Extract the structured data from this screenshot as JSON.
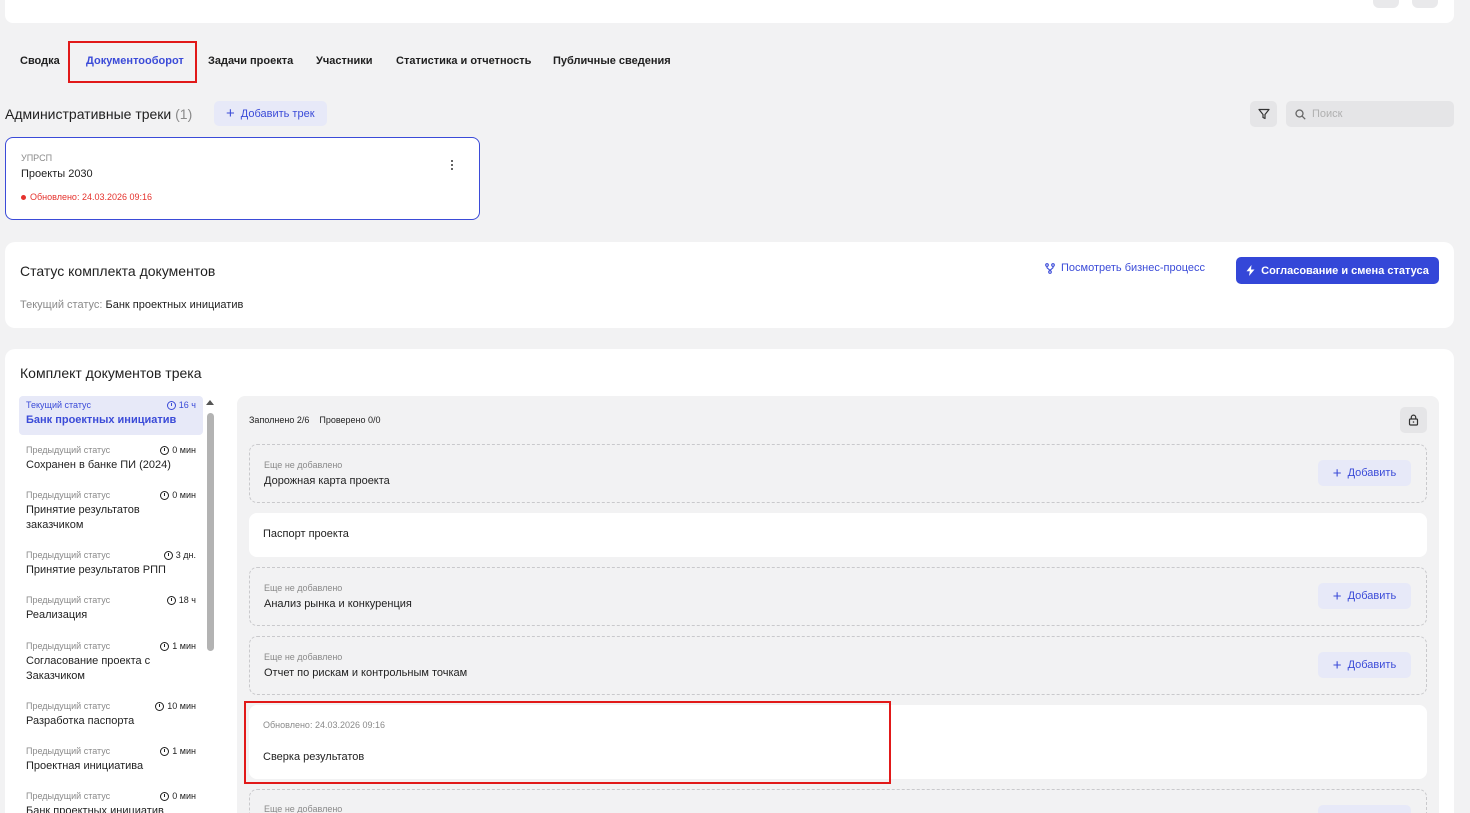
{
  "tabs": [
    {
      "label": "Сводка"
    },
    {
      "label": "Документооборот"
    },
    {
      "label": "Задачи проекта"
    },
    {
      "label": "Участники"
    },
    {
      "label": "Статистика и отчетность"
    },
    {
      "label": "Публичные сведения"
    }
  ],
  "active_tab": "Документооборот",
  "admin_tracks": {
    "title": "Административные треки",
    "count": "(1)",
    "add_label": "Добавить трек",
    "search_placeholder": "Поиск"
  },
  "track": {
    "code": "УПРСП",
    "name": "Проекты 2030",
    "updated": "Обновлено: 24.03.2026 09:16"
  },
  "status_card": {
    "title": "Статус комплекта документов",
    "current_label": "Текущий статус:",
    "current_value": "Банк проектных инициатив",
    "view_process": "Посмотреть бизнес-процесс",
    "approve_button": "Согласование и смена статуса"
  },
  "docs": {
    "title": "Комплект документов трека",
    "filled": "Заполнено 2/6",
    "checked": "Проверено 0/0",
    "add_label": "Добавить",
    "items": [
      {
        "sub": "Еще не добавлено",
        "name": "Дорожная карта проекта"
      },
      {
        "sub": "",
        "name": "Паспорт проекта"
      },
      {
        "sub": "Еще не добавлено",
        "name": "Анализ рынка и конкуренция"
      },
      {
        "sub": "Еще не добавлено",
        "name": "Отчет по рискам и контрольным точкам"
      },
      {
        "sub": "Обновлено: 24.03.2026 09:16",
        "name": "Сверка результатов"
      },
      {
        "sub": "Еще не добавлено",
        "name": ""
      }
    ]
  },
  "statuses": [
    {
      "label": "Текущий статус",
      "time": "16 ч",
      "name": "Банк проектных инициатив"
    },
    {
      "label": "Предыдущий статус",
      "time": "0 мин",
      "name": "Сохранен в банке ПИ (2024)"
    },
    {
      "label": "Предыдущий статус",
      "time": "0 мин",
      "name": "Принятие результатов заказчиком"
    },
    {
      "label": "Предыдущий статус",
      "time": "3 дн.",
      "name": "Принятие результатов РПП"
    },
    {
      "label": "Предыдущий статус",
      "time": "18 ч",
      "name": "Реализация"
    },
    {
      "label": "Предыдущий статус",
      "time": "1 мин",
      "name": "Согласование проекта с Заказчиком"
    },
    {
      "label": "Предыдущий статус",
      "time": "10 мин",
      "name": "Разработка паспорта"
    },
    {
      "label": "Предыдущий статус",
      "time": "1 мин",
      "name": "Проектная инициатива"
    },
    {
      "label": "Предыдущий статус",
      "time": "0 мин",
      "name": "Банк проектных инициатив"
    }
  ],
  "colors": {
    "accent": "#3447d8",
    "highlight": "#e11919",
    "updated": "#e5322d"
  }
}
